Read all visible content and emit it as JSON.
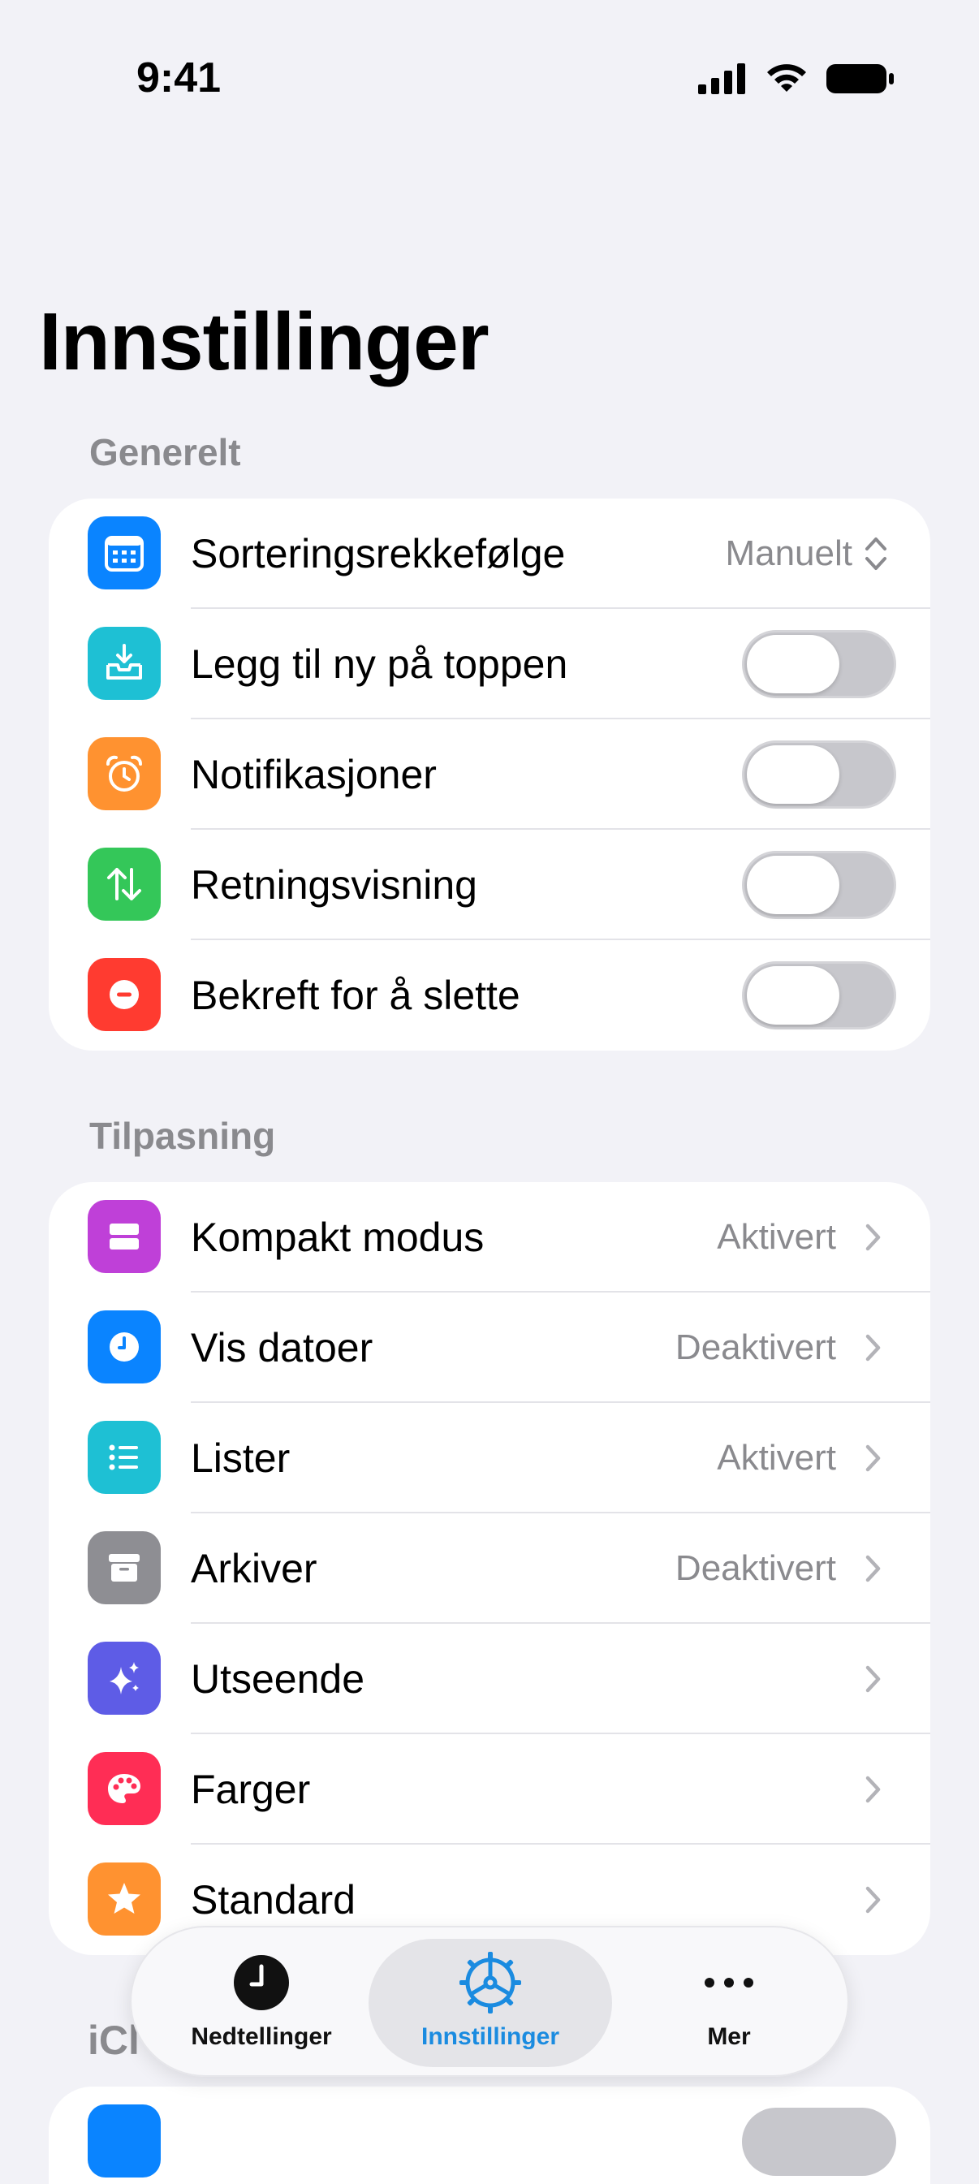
{
  "status_bar": {
    "time": "9:41"
  },
  "title": "Innstillinger",
  "sections": {
    "generelt": {
      "header": "Generelt",
      "rows": {
        "sort": {
          "label": "Sorteringsrekkefølge",
          "value": "Manuelt",
          "icon": "calendar-icon",
          "color": "#0a84ff"
        },
        "add_top": {
          "label": "Legg til ny på toppen",
          "on": false,
          "icon": "tray-icon",
          "color": "#1ec0d4"
        },
        "notif": {
          "label": "Notifikasjoner",
          "on": false,
          "icon": "alarm-icon",
          "color": "#ff9230"
        },
        "direction": {
          "label": "Retningsvisning",
          "on": false,
          "icon": "arrows-updown-icon",
          "color": "#34c759"
        },
        "confirm_delete": {
          "label": "Bekreft for å slette",
          "on": false,
          "icon": "minus-circle-icon",
          "color": "#ff3b30"
        }
      }
    },
    "tilpasning": {
      "header": "Tilpasning",
      "rows": {
        "compact": {
          "label": "Kompakt modus",
          "value": "Aktivert",
          "icon": "rectangles-icon",
          "color": "#bf40d8"
        },
        "dates": {
          "label": "Vis datoer",
          "value": "Deaktivert",
          "icon": "clock-icon",
          "color": "#0a84ff"
        },
        "lists": {
          "label": "Lister",
          "value": "Aktivert",
          "icon": "list-icon",
          "color": "#1ec0d4"
        },
        "archive": {
          "label": "Arkiver",
          "value": "Deaktivert",
          "icon": "archive-box-icon",
          "color": "#8e8e93"
        },
        "appearance": {
          "label": "Utseende",
          "value": "",
          "icon": "sparkles-icon",
          "color": "#5e5ce6"
        },
        "colors": {
          "label": "Farger",
          "value": "",
          "icon": "palette-icon",
          "color": "#ff2d55"
        },
        "default": {
          "label": "Standard",
          "value": "",
          "icon": "star-icon",
          "color": "#ff9230"
        }
      }
    },
    "icloud": {
      "header_peek": "iCl"
    }
  },
  "tab_bar": {
    "tabs": [
      {
        "label": "Nedtellinger",
        "icon": "clock-fill-icon",
        "active": false
      },
      {
        "label": "Innstillinger",
        "icon": "gear-icon",
        "active": true
      },
      {
        "label": "Mer",
        "icon": "ellipsis-icon",
        "active": false
      }
    ]
  },
  "accent_color": "#1a8be0"
}
